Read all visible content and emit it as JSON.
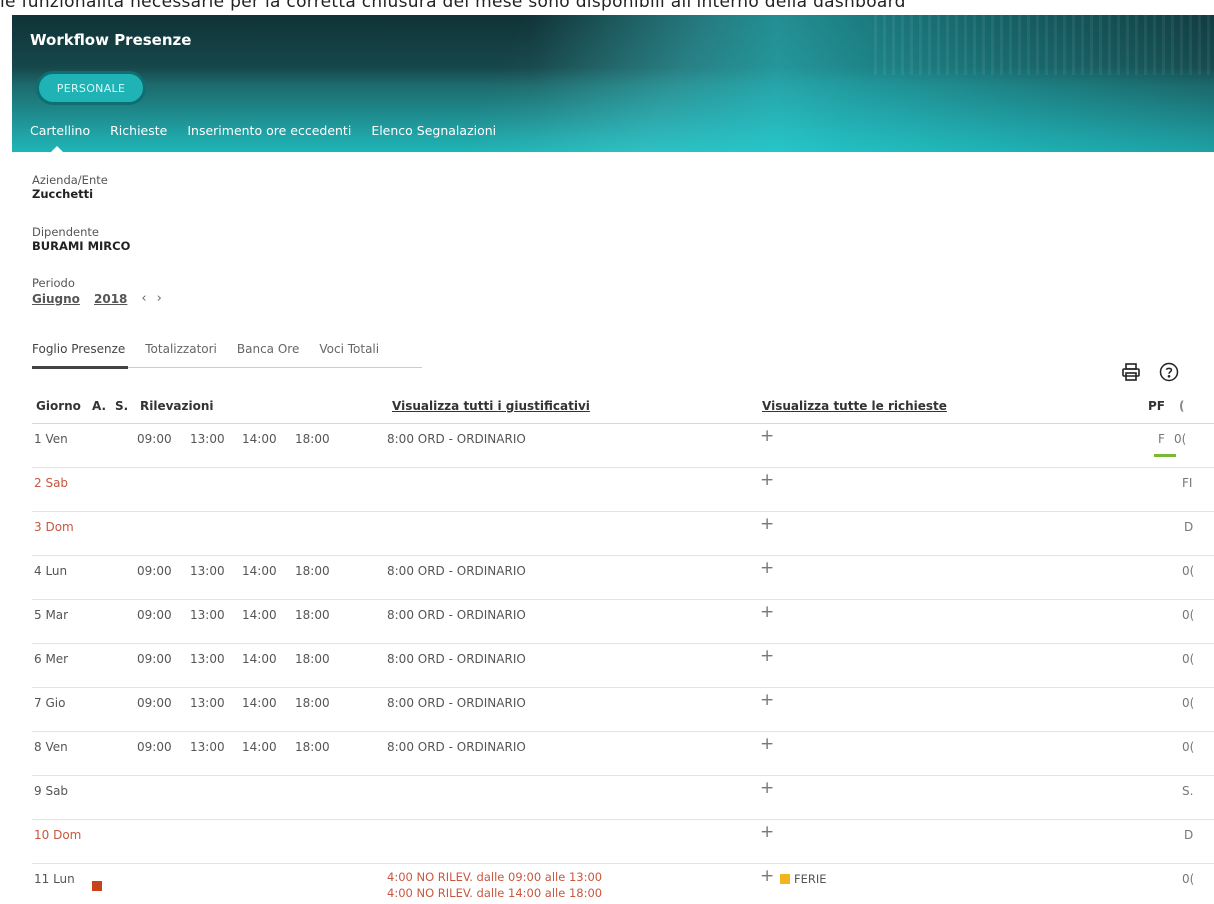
{
  "top_banner": "le funzionalità necessarie per la corretta chiusura del mese sono disponibili all'interno della dashboard",
  "header": {
    "title": "Workflow Presenze",
    "persona_button": "PERSONALE",
    "nav": [
      "Cartellino",
      "Richieste",
      "Inserimento ore eccedenti",
      "Elenco Segnalazioni"
    ],
    "active_nav": "Cartellino"
  },
  "info": {
    "azienda_label": "Azienda/Ente",
    "azienda_value": "Zucchetti",
    "dipendente_label": "Dipendente",
    "dipendente_value": "BURAMI MIRCO",
    "periodo_label": "Periodo",
    "periodo_month": "Giugno",
    "periodo_year": "2018",
    "prev_arrow": "‹",
    "next_arrow": "›"
  },
  "subtabs": [
    "Foglio Presenze",
    "Totalizzatori",
    "Banca Ore",
    "Voci Totali"
  ],
  "toolbar": {
    "print_icon": "print-icon",
    "help_icon": "help-icon"
  },
  "table": {
    "headers": {
      "giorno": "Giorno",
      "a": "A.",
      "s": "S.",
      "rilevazioni": "Rilevazioni",
      "giustificativi": "Visualizza tutti i giustificativi",
      "richieste": "Visualizza tutte le richieste",
      "pf": "PF",
      "extra": "("
    },
    "rows": [
      {
        "day": "1 Ven",
        "weekend": false,
        "times": [
          "09:00",
          "13:00",
          "14:00",
          "18:00"
        ],
        "giust": "8:00 ORD - ORDINARIO",
        "pf": "F",
        "extra": "0("
      },
      {
        "day": "2 Sab",
        "weekend": true,
        "times": [],
        "giust": "",
        "pf": "",
        "extra": "FI"
      },
      {
        "day": "3 Dom",
        "weekend": true,
        "times": [],
        "giust": "",
        "pf": "",
        "extra": "D"
      },
      {
        "day": "4 Lun",
        "weekend": false,
        "times": [
          "09:00",
          "13:00",
          "14:00",
          "18:00"
        ],
        "giust": "8:00 ORD - ORDINARIO",
        "pf": "",
        "extra": "0("
      },
      {
        "day": "5 Mar",
        "weekend": false,
        "times": [
          "09:00",
          "13:00",
          "14:00",
          "18:00"
        ],
        "giust": "8:00 ORD - ORDINARIO",
        "pf": "",
        "extra": "0("
      },
      {
        "day": "6 Mer",
        "weekend": false,
        "times": [
          "09:00",
          "13:00",
          "14:00",
          "18:00"
        ],
        "giust": "8:00 ORD - ORDINARIO",
        "pf": "",
        "extra": "0("
      },
      {
        "day": "7 Gio",
        "weekend": false,
        "times": [
          "09:00",
          "13:00",
          "14:00",
          "18:00"
        ],
        "giust": "8:00 ORD - ORDINARIO",
        "pf": "",
        "extra": "0("
      },
      {
        "day": "8 Ven",
        "weekend": false,
        "times": [
          "09:00",
          "13:00",
          "14:00",
          "18:00"
        ],
        "giust": "8:00 ORD - ORDINARIO",
        "pf": "",
        "extra": "0("
      },
      {
        "day": "9 Sab",
        "weekend": false,
        "times": [],
        "giust": "",
        "pf": "",
        "extra": "S."
      },
      {
        "day": "10 Dom",
        "weekend": true,
        "times": [],
        "giust": "",
        "pf": "",
        "extra": "D"
      },
      {
        "day": "11 Lun",
        "weekend": false,
        "times": [],
        "giust_lines": [
          "4:00 NO RILEV. dalle 09:00 alle 13:00",
          "4:00 NO RILEV. dalle 14:00 alle 18:00"
        ],
        "richiesta": "FERIE",
        "pf": "",
        "extra": "0("
      }
    ],
    "plus_symbol": "+"
  }
}
